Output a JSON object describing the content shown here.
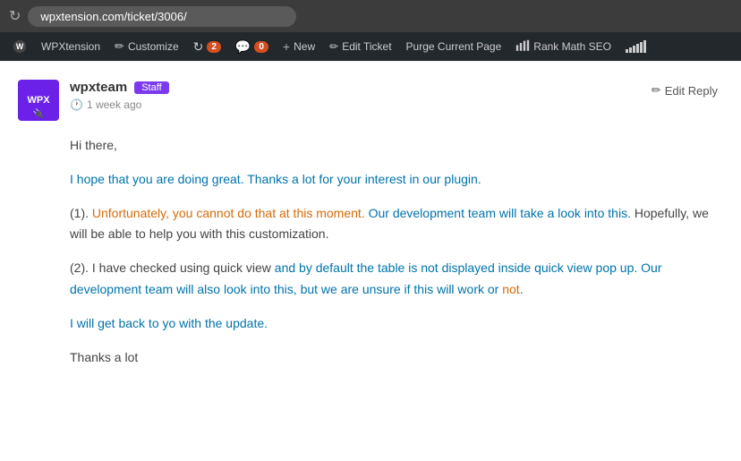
{
  "browser": {
    "refresh_icon": "↻",
    "url": "wpxtension.com/ticket/3006/"
  },
  "adminbar": {
    "site_name": "WPXtension",
    "customize_label": "Customize",
    "comments_count": "0",
    "new_label": "New",
    "edit_ticket_label": "Edit Ticket",
    "purge_label": "Purge Current Page",
    "rankmath_label": "Rank Math SEO",
    "updates_count": "2"
  },
  "reply": {
    "author": "wpxteam",
    "staff_badge": "Staff",
    "time": "1 week ago",
    "edit_reply_label": "Edit Reply",
    "body": {
      "line1": "Hi there,",
      "line2": "I hope that you are doing great. Thanks a lot for your interest in our plugin.",
      "line3_prefix": "(1). ",
      "line3_orange": "Unfortunately, you cannot do that at this moment.",
      "line3_blue": " Our development team will take a look into this.",
      "line3_suffix": " Hopefully, we will be able to help you with this customization.",
      "line4_prefix": "(2). I have checked using quick view ",
      "line4_blue1": "and by default the table is not displayed inside quick view pop up.",
      "line4_blue2": " Our development team will also look into this, but we are unsure if this will work or ",
      "line4_orange": "not",
      "line4_suffix": ".",
      "line5": "I will get back to yo with the update.",
      "line6": "Thanks a lot"
    }
  }
}
